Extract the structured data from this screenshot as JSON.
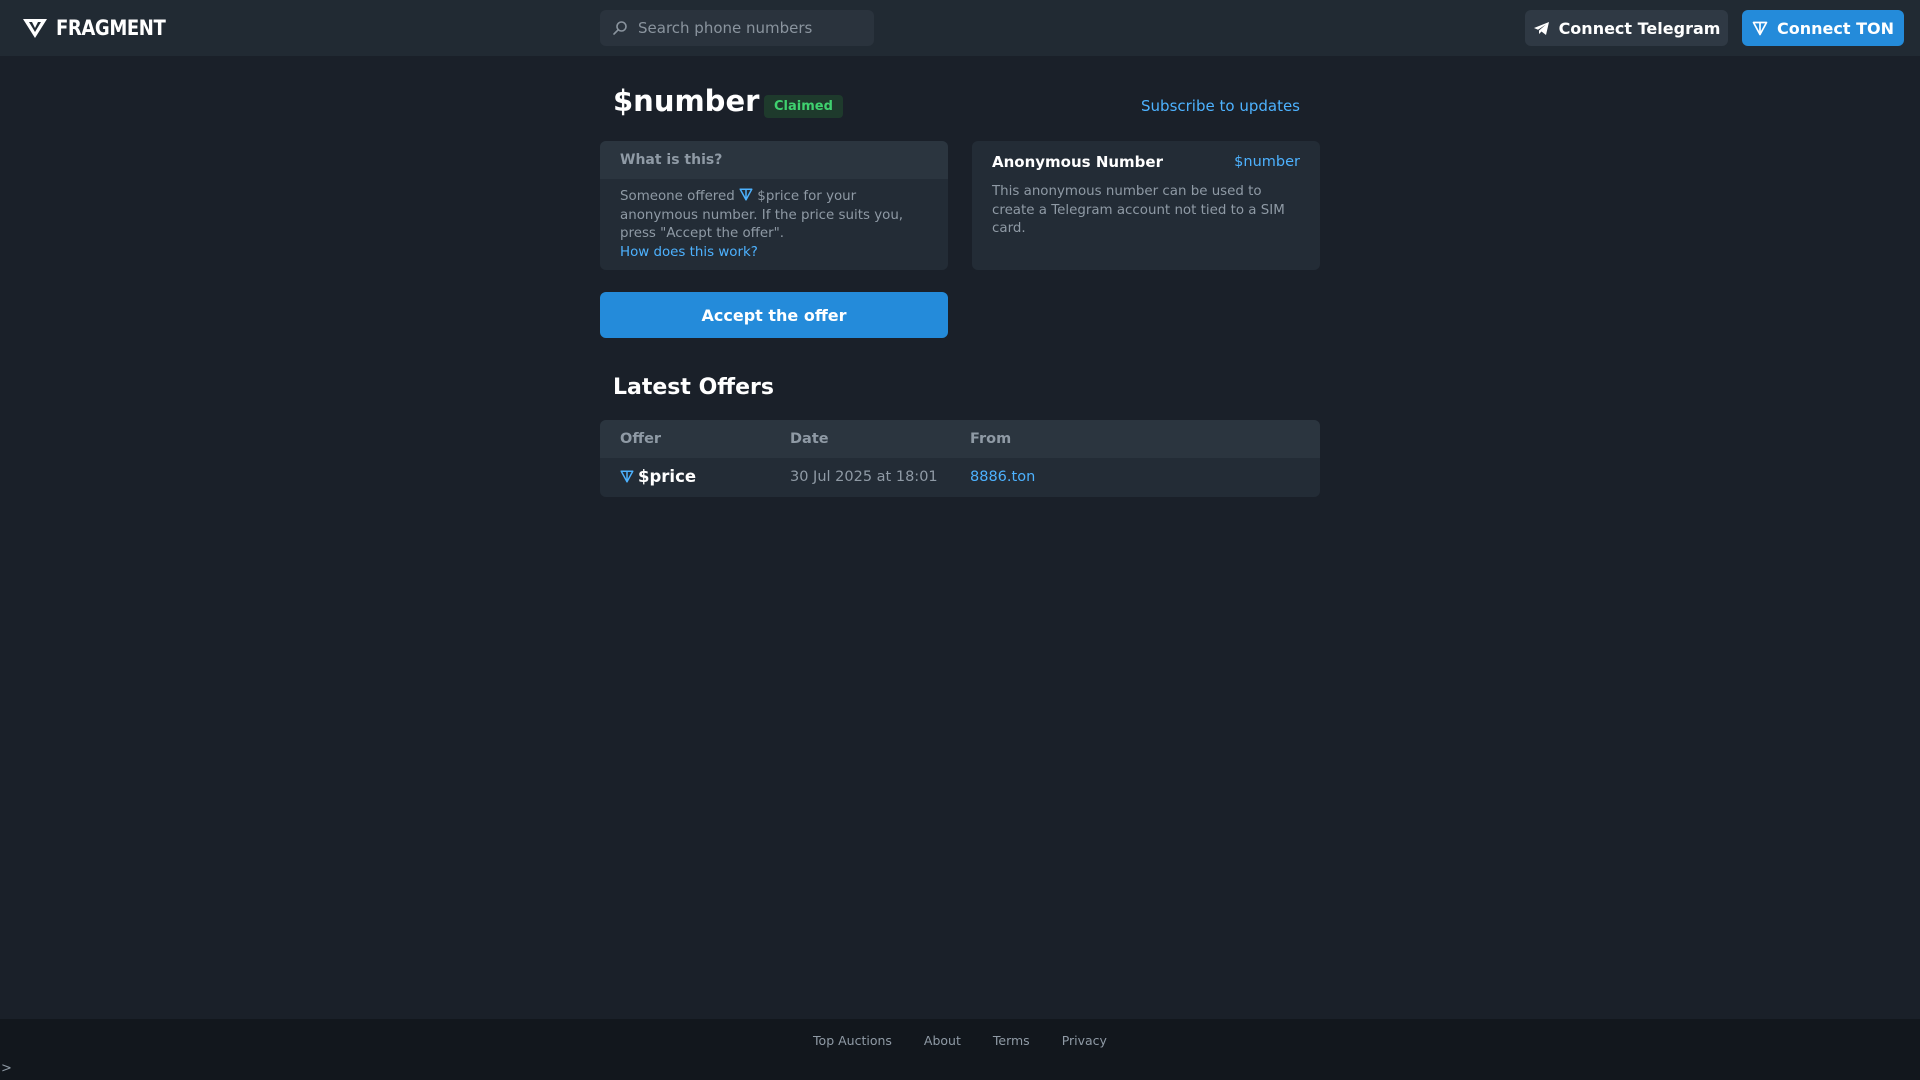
{
  "header": {
    "logo_text": "FRAGMENT",
    "search_placeholder": "Search phone numbers",
    "connect_telegram_label": "Connect Telegram",
    "connect_ton_label": "Connect TON"
  },
  "main": {
    "title": "$number",
    "status_badge": "Claimed",
    "subscribe_label": "Subscribe to updates",
    "what_card": {
      "heading": "What is this?",
      "text_before": "Someone offered",
      "text_after": "$price for your anonymous number. If the price suits you, press \"Accept the offer\".",
      "link": "How does this work?"
    },
    "anon_card": {
      "title": "Anonymous Number",
      "number": "$number",
      "description": "This anonymous number can be used to create a Telegram account not tied to a SIM card."
    },
    "accept_label": "Accept the offer"
  },
  "offers": {
    "title": "Latest Offers",
    "columns": [
      "Offer",
      "Date",
      "From"
    ],
    "rows": [
      {
        "offer": "$price",
        "date": "30 Jul 2025 at 18:01",
        "from": "8886.ton"
      }
    ]
  },
  "footer": {
    "links": [
      "Top Auctions",
      "About",
      "Terms",
      "Privacy"
    ],
    "prompt": ">"
  },
  "colors": {
    "accent": "#248bda",
    "link": "#4db2ff",
    "claimed": "#3fd16f",
    "background": "#1a2029"
  },
  "icons": [
    "fragment-logo-icon",
    "search-icon",
    "telegram-plane-icon",
    "ton-icon"
  ]
}
